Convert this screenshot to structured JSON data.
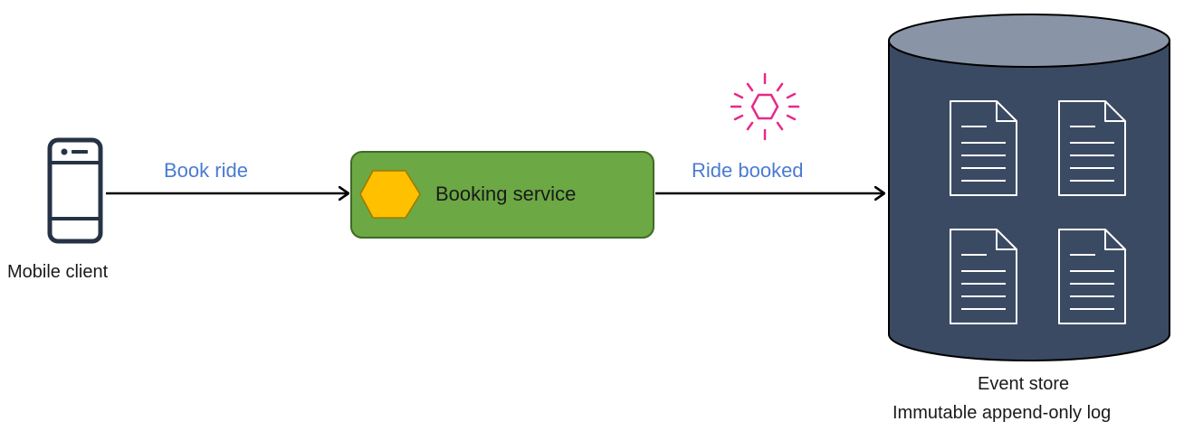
{
  "nodes": {
    "client": {
      "label": "Mobile client",
      "icon": "smartphone-icon"
    },
    "service": {
      "label": "Booking service",
      "icon": "hexagon-icon",
      "fill": "#6ca844",
      "border": "#3f6b24",
      "icon_fill": "#ffc000"
    },
    "store": {
      "label": "Event store",
      "sublabel": "Immutable append-only log",
      "icon": "document-icon",
      "body_fill": "#3b4a63",
      "top_fill": "#8995a6"
    }
  },
  "edges": {
    "request": {
      "from": "client",
      "to": "service",
      "label": "Book ride"
    },
    "event": {
      "from": "service",
      "to": "store",
      "label": "Ride booked"
    }
  },
  "colors": {
    "edge_label": "#4a7bd0",
    "event_icon": "#e8288a",
    "arrow": "#000000"
  },
  "event_icon": "event-burst-icon"
}
